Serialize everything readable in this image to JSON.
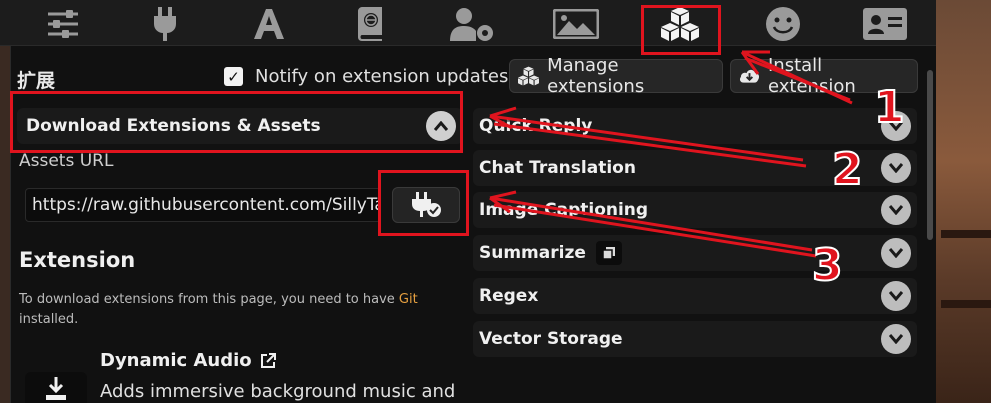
{
  "topbar": {
    "icons": [
      "sliders-icon",
      "plug-icon",
      "font-icon",
      "book-globe-icon",
      "user-gear-icon",
      "image-icon",
      "cubes-icon",
      "smile-icon",
      "id-card-icon"
    ]
  },
  "panel": {
    "title": "扩展",
    "notify_label": "Notify on extension updates",
    "notify_checked": true,
    "manage_button": "Manage extensions",
    "install_button": "Install extension",
    "download_section": "Download Extensions & Assets",
    "assets_url_label": "Assets URL",
    "assets_url_value": "https://raw.githubusercontent.com/SillyTavern",
    "extension_heading": "Extension",
    "extension_desc_before": "To download extensions from this page, you need to have ",
    "extension_desc_link": "Git",
    "extension_desc_after": " installed.",
    "dynamic_audio_name": "Dynamic Audio",
    "dynamic_audio_desc": "Adds immersive background music and"
  },
  "extensions_list": [
    {
      "label": "Quick Reply"
    },
    {
      "label": "Chat Translation"
    },
    {
      "label": "Image Captioning"
    },
    {
      "label": "Summarize"
    },
    {
      "label": "Regex"
    },
    {
      "label": "Vector Storage"
    }
  ],
  "annotations": {
    "callout_1": "1",
    "callout_2": "2",
    "callout_3": "3",
    "color": "#e0141e"
  }
}
